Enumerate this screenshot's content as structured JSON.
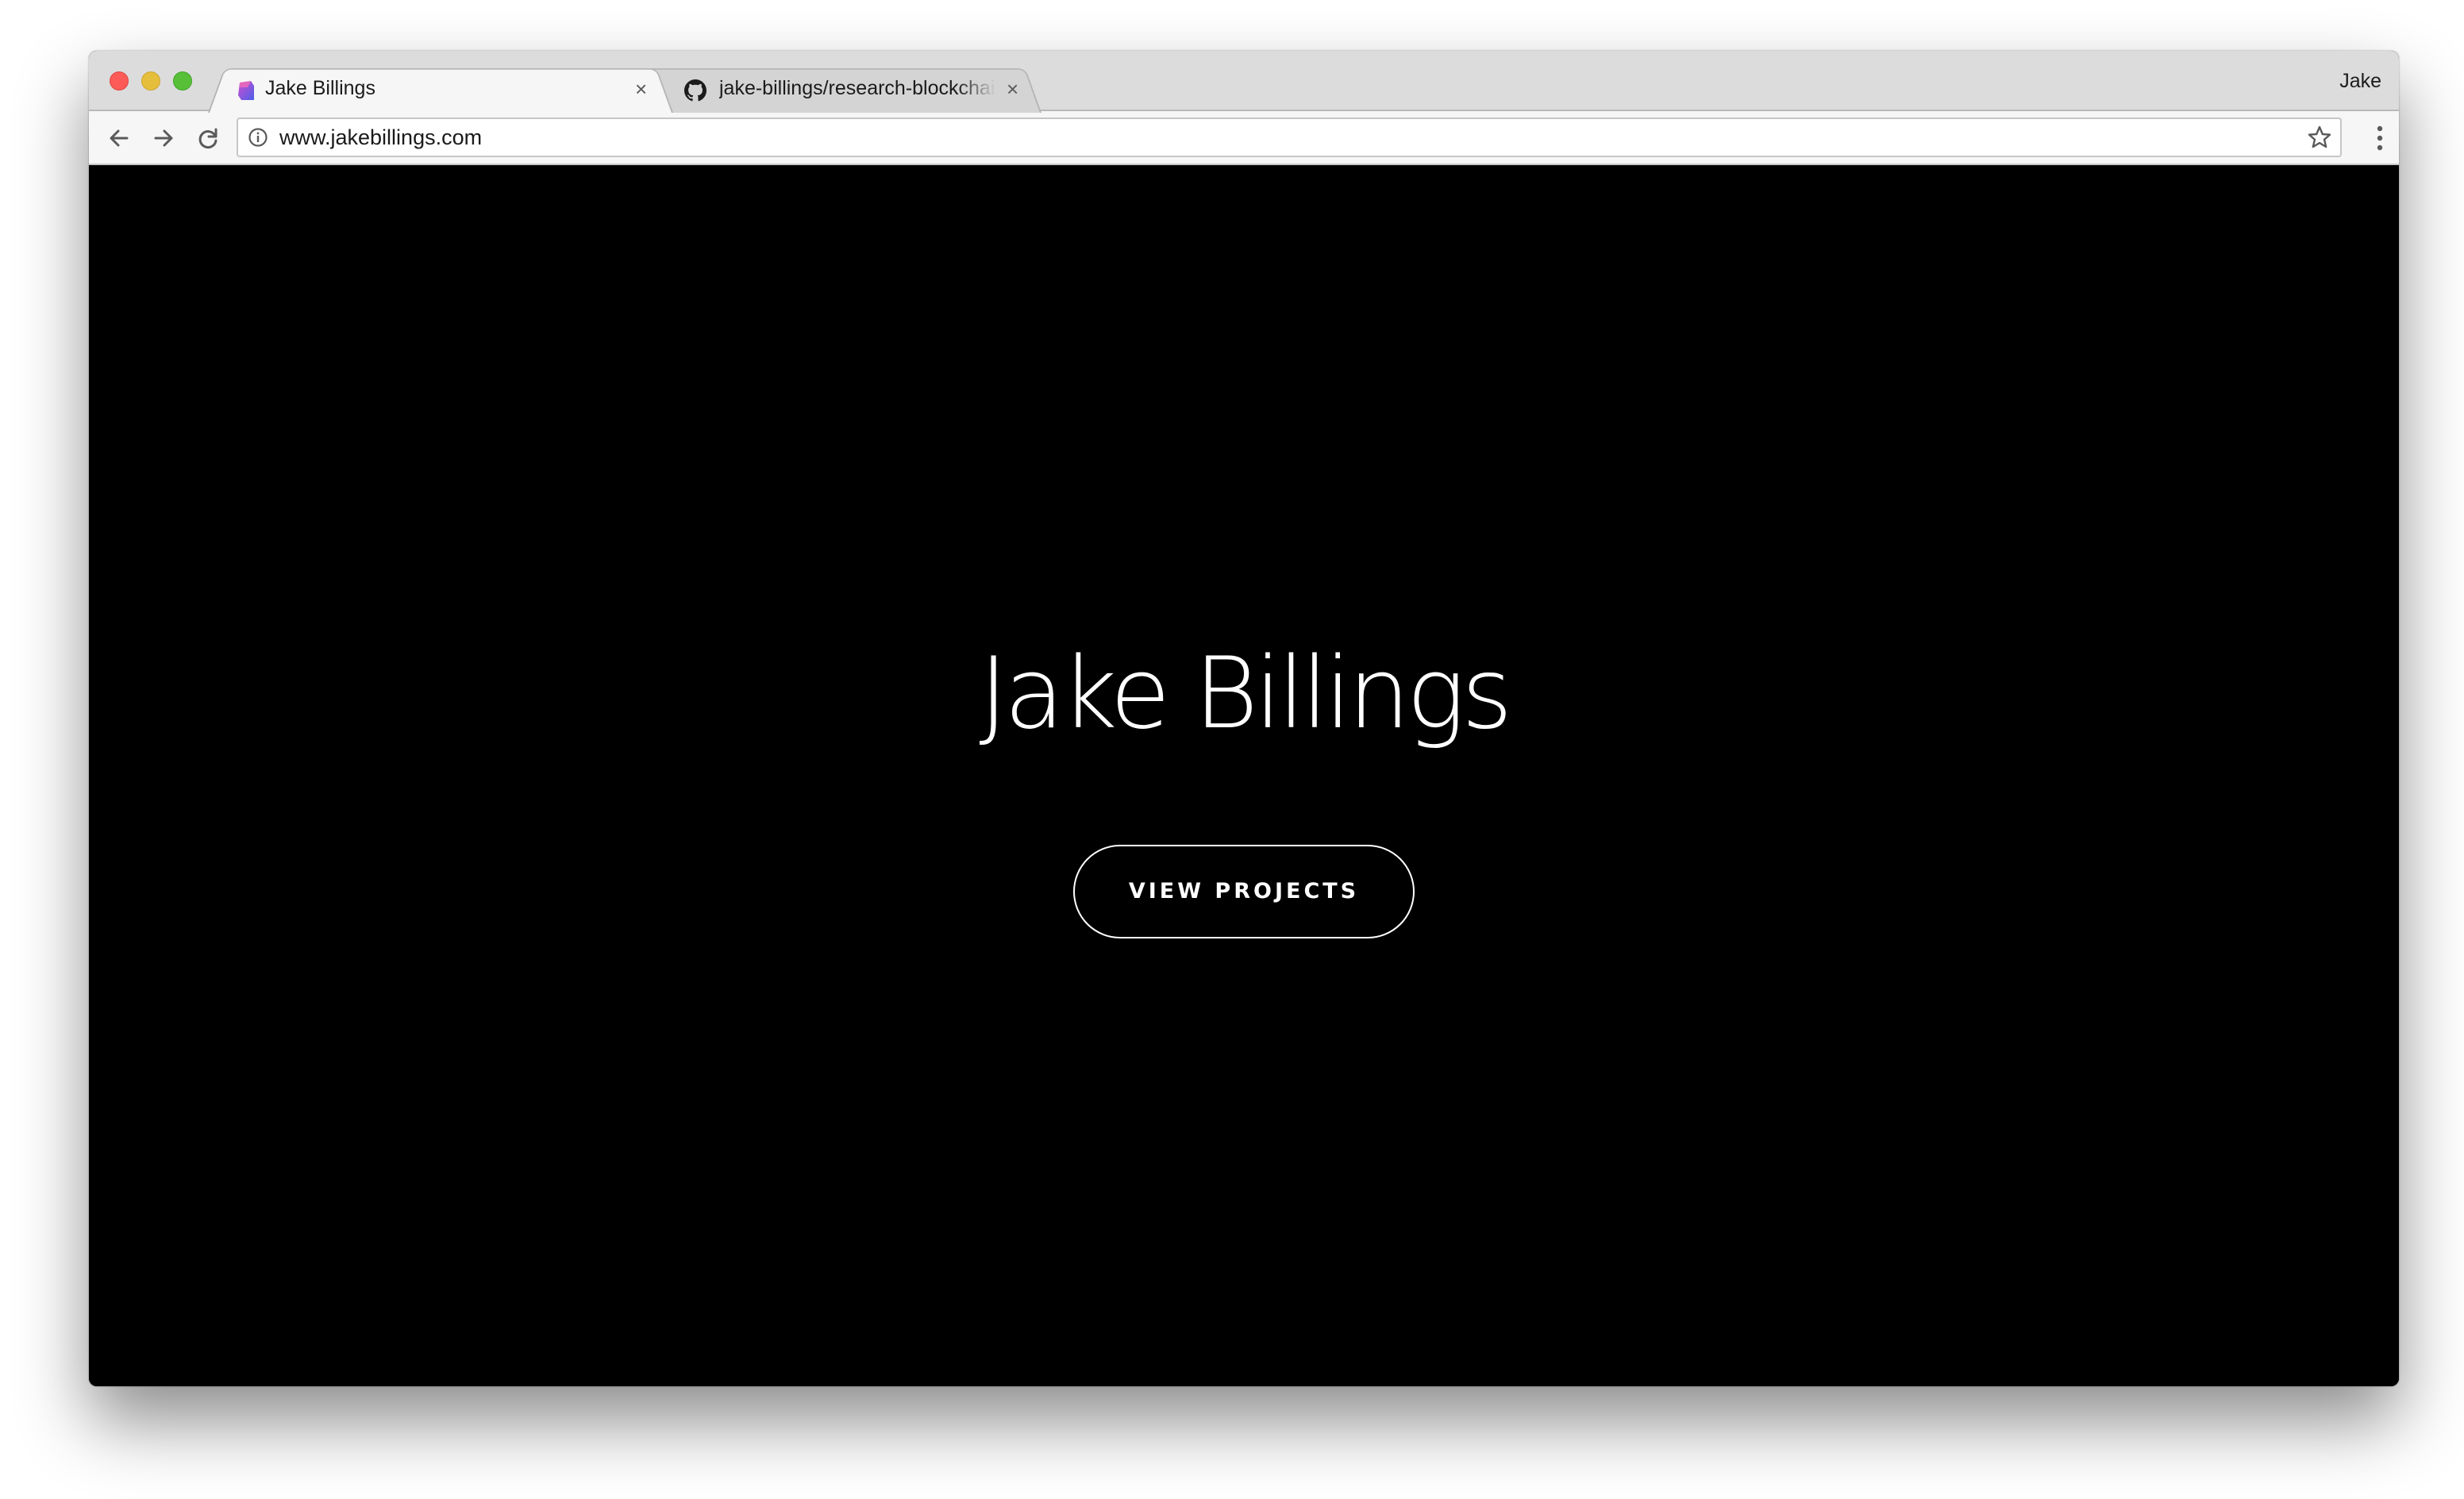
{
  "browser": {
    "tabs": [
      {
        "title": "Jake Billings",
        "active": true,
        "favicon": "jake-billings-logo-icon",
        "close_label": "×"
      },
      {
        "title": "jake-billings/research-blockchain",
        "active": false,
        "favicon": "github-icon",
        "close_label": "×"
      }
    ],
    "profile_name": "Jake",
    "address_bar": {
      "url": "www.jakebillings.com"
    }
  },
  "page": {
    "title": "Jake Billings",
    "cta_label": "VIEW PROJECTS",
    "background": "#000000",
    "text_color": "#ffffff"
  }
}
